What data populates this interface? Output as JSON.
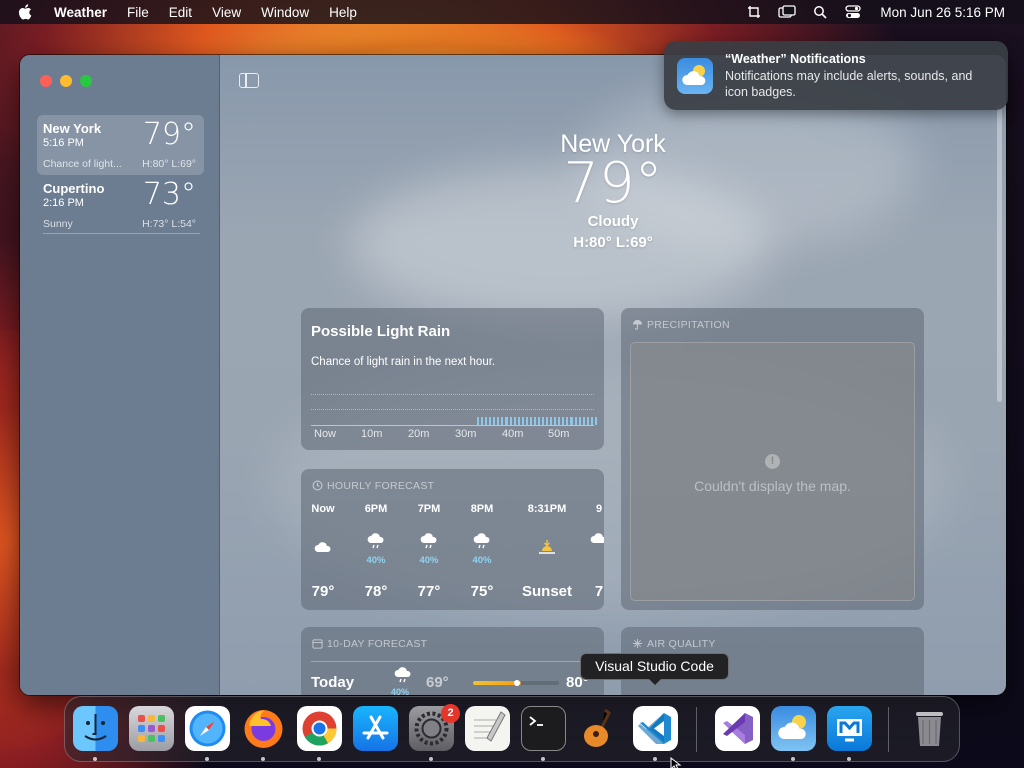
{
  "menubar": {
    "app_name": "Weather",
    "menus": [
      "File",
      "Edit",
      "View",
      "Window",
      "Help"
    ],
    "clock": "Mon Jun 26  5:16 PM",
    "status_icons": [
      "screenshot-icon",
      "screen-mirroring-icon",
      "spotlight-icon",
      "control-center-icon"
    ]
  },
  "sidebar": {
    "locations": [
      {
        "city": "New York",
        "time": "5:16 PM",
        "temp": "79°",
        "condition": "Chance of light...",
        "hl": "H:80°  L:69°"
      },
      {
        "city": "Cupertino",
        "time": "2:16 PM",
        "temp": "73°",
        "condition": "Sunny",
        "hl": "H:73°  L:54°"
      }
    ]
  },
  "main": {
    "city": "New York",
    "temp": "79°",
    "condition": "Cloudy",
    "high_low": "H:80°  L:69°"
  },
  "rain_card": {
    "title": "Possible Light Rain",
    "description": "Chance of light rain in the next hour.",
    "labels": [
      "Now",
      "10m",
      "20m",
      "30m",
      "40m",
      "50m"
    ]
  },
  "hourly": {
    "title": "HOURLY FORECAST",
    "hours": [
      {
        "time": "Now",
        "icon": "cloud-icon",
        "pct": "",
        "temp": "79°"
      },
      {
        "time": "6PM",
        "icon": "cloud-rain-icon",
        "pct": "40%",
        "temp": "78°"
      },
      {
        "time": "7PM",
        "icon": "cloud-rain-icon",
        "pct": "40%",
        "temp": "77°"
      },
      {
        "time": "8PM",
        "icon": "cloud-rain-icon",
        "pct": "40%",
        "temp": "75°"
      },
      {
        "time": "8:31PM",
        "icon": "sunset-icon",
        "pct": "",
        "temp": "Sunset"
      },
      {
        "time": "9",
        "icon": "cloud-rain-icon",
        "pct": "",
        "temp": "7"
      }
    ]
  },
  "precipitation": {
    "title": "PRECIPITATION",
    "map_message": "Couldn't display the map."
  },
  "ten_day": {
    "title": "10-DAY FORECAST",
    "today": {
      "label": "Today",
      "pct": "40%",
      "low": "69°",
      "high": "80°"
    }
  },
  "air_quality": {
    "title": "AIR QUALITY"
  },
  "notification": {
    "title": "“Weather” Notifications",
    "body": "Notifications may include alerts, sounds, and icon badges."
  },
  "dock": {
    "tooltip": "Visual Studio Code",
    "apps": [
      "Finder",
      "Launchpad",
      "Safari",
      "Firefox",
      "Chrome",
      "App Store",
      "System Settings",
      "TextEdit",
      "Terminal",
      "GarageBand",
      "Visual Studio Code",
      "Visual Studio",
      "Weather",
      "Microsoft Remote Desktop",
      "Trash"
    ],
    "settings_badge": "2"
  },
  "colors": {
    "rain_bar": "#8ec7e8",
    "precip_pct": "#8fd3f0",
    "badge": "#e5362c"
  }
}
